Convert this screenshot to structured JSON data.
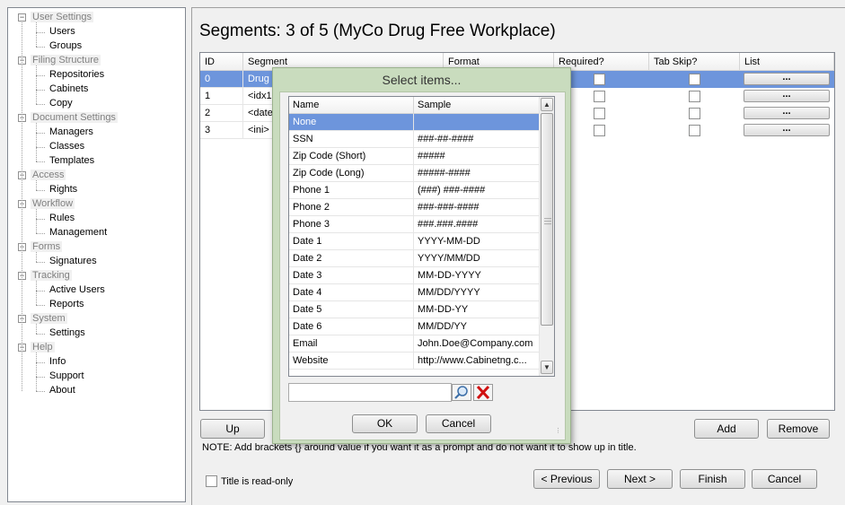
{
  "tree": [
    {
      "label": "User Settings",
      "children": [
        "Users",
        "Groups"
      ]
    },
    {
      "label": "Filing Structure",
      "children": [
        "Repositories",
        "Cabinets",
        "Copy"
      ]
    },
    {
      "label": "Document Settings",
      "children": [
        "Managers",
        "Classes",
        "Templates"
      ]
    },
    {
      "label": "Access",
      "children": [
        "Rights"
      ]
    },
    {
      "label": "Workflow",
      "children": [
        "Rules",
        "Management"
      ]
    },
    {
      "label": "Forms",
      "children": [
        "Signatures"
      ]
    },
    {
      "label": "Tracking",
      "children": [
        "Active Users",
        "Reports"
      ]
    },
    {
      "label": "System",
      "children": [
        "Settings"
      ]
    },
    {
      "label": "Help",
      "children": [
        "Info",
        "Support",
        "About"
      ]
    }
  ],
  "page": {
    "title": "Segments: 3 of 5 (MyCo Drug Free Workplace)"
  },
  "grid": {
    "columns": [
      "ID",
      "Segment",
      "Format",
      "Required?",
      "Tab Skip?",
      "List"
    ],
    "rows": [
      {
        "id": "0",
        "segment": "Drug F",
        "selected": true
      },
      {
        "id": "1",
        "segment": "<idx1",
        "selected": false
      },
      {
        "id": "2",
        "segment": "<date",
        "selected": false
      },
      {
        "id": "3",
        "segment": "<ini>",
        "selected": false
      }
    ],
    "list_button_label": "..."
  },
  "buttons": {
    "up": "Up",
    "add": "Add",
    "remove": "Remove",
    "previous": "< Previous",
    "next": "Next >",
    "finish": "Finish",
    "cancel": "Cancel"
  },
  "note": "NOTE: Add brackets {} around value if you want it as a prompt and do not want it to show up in title.",
  "title_readonly_label": "Title is read-only",
  "dialog": {
    "title": "Select items...",
    "columns": [
      "Name",
      "Sample"
    ],
    "items": [
      {
        "name": "None",
        "sample": ""
      },
      {
        "name": "SSN",
        "sample": "###-##-####"
      },
      {
        "name": "Zip Code (Short)",
        "sample": "#####"
      },
      {
        "name": "Zip Code (Long)",
        "sample": "#####-####"
      },
      {
        "name": "Phone 1",
        "sample": "(###) ###-####"
      },
      {
        "name": "Phone 2",
        "sample": "###-###-####"
      },
      {
        "name": "Phone 3",
        "sample": "###.###.####"
      },
      {
        "name": "Date 1",
        "sample": "YYYY-MM-DD"
      },
      {
        "name": "Date 2",
        "sample": "YYYY/MM/DD"
      },
      {
        "name": "Date 3",
        "sample": "MM-DD-YYYY"
      },
      {
        "name": "Date 4",
        "sample": "MM/DD/YYYY"
      },
      {
        "name": "Date 5",
        "sample": "MM-DD-YY"
      },
      {
        "name": "Date 6",
        "sample": "MM/DD/YY"
      },
      {
        "name": "Email",
        "sample": "John.Doe@Company.com"
      },
      {
        "name": "Website",
        "sample": "http://www.Cabinetng.c..."
      }
    ],
    "search_value": "",
    "ok_label": "OK",
    "cancel_label": "Cancel"
  },
  "colors": {
    "selection": "#6d95dc",
    "dialog_frame": "#c9dcbe"
  }
}
